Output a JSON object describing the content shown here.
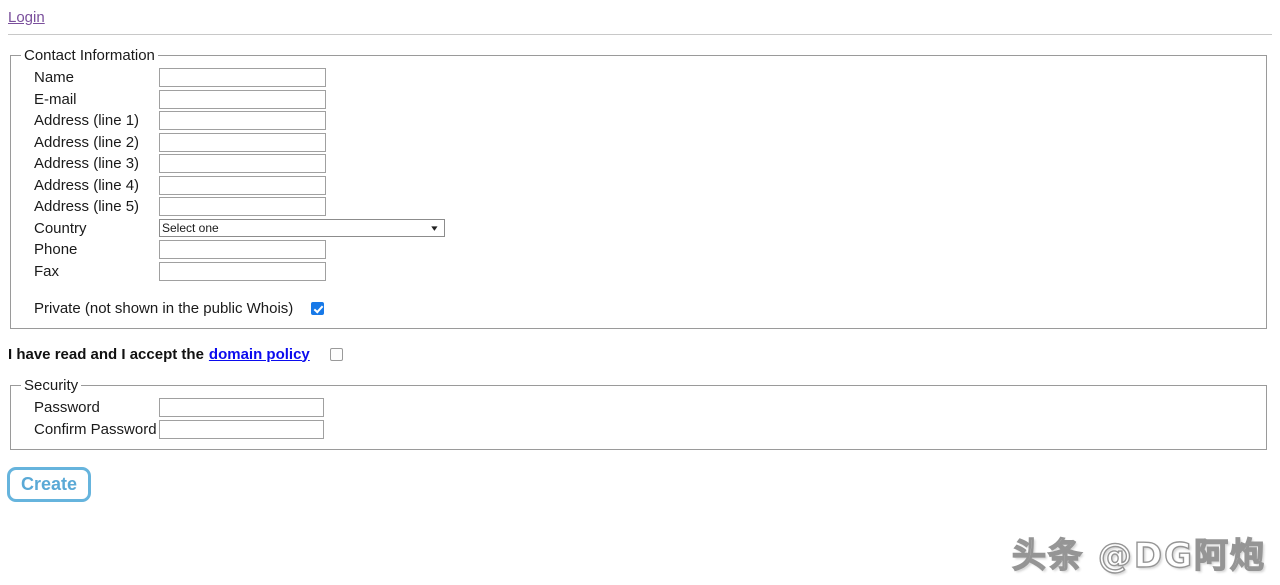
{
  "header": {
    "login_label": "Login"
  },
  "contact": {
    "legend": "Contact Information",
    "fields": [
      {
        "label": "Name",
        "value": "",
        "placeholder": ""
      },
      {
        "label": "E-mail",
        "value": "",
        "placeholder": ""
      },
      {
        "label": "Address (line 1)",
        "value": "",
        "placeholder": ""
      },
      {
        "label": "Address (line 2)",
        "value": "",
        "placeholder": ""
      },
      {
        "label": "Address (line 3)",
        "value": "",
        "placeholder": ""
      },
      {
        "label": "Address (line 4)",
        "value": "",
        "placeholder": ""
      },
      {
        "label": "Address (line 5)",
        "value": "",
        "placeholder": ""
      }
    ],
    "country": {
      "label": "Country",
      "selected": "Select one",
      "chevron": "❯"
    },
    "phone": {
      "label": "Phone",
      "value": "",
      "placeholder": ""
    },
    "fax": {
      "label": "Fax",
      "value": "",
      "placeholder": ""
    },
    "private": {
      "label": "Private (not shown in the public Whois)",
      "checked": true
    }
  },
  "accept": {
    "text": "I have read and I accept the",
    "link_label": "domain policy",
    "checked": false
  },
  "security": {
    "legend": "Security",
    "password": {
      "label": "Password",
      "value": "",
      "placeholder": ""
    },
    "confirm_password": {
      "label": "Confirm Password",
      "value": "",
      "placeholder": ""
    }
  },
  "actions": {
    "create_label": "Create"
  },
  "watermark": {
    "text": "头条 @DG阿炮"
  },
  "colors": {
    "login_link": "#7a4f9c",
    "policy_link": "#0b0bee",
    "checkbox_checked": "#1779e8",
    "create_border": "#66b4dd",
    "create_text": "#5aa9d6",
    "fieldset_border": "#9a9a9a"
  }
}
